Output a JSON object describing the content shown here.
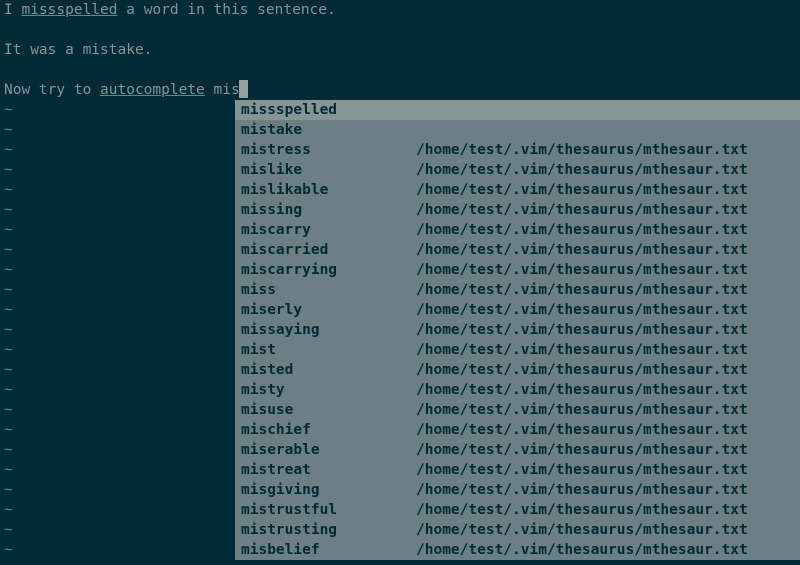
{
  "buffer": {
    "lines": [
      {
        "segments": [
          {
            "text": "I ",
            "cls": ""
          },
          {
            "text": "missspelled",
            "cls": "spell-error"
          },
          {
            "text": " a word in this sentence.",
            "cls": ""
          }
        ]
      },
      {
        "segments": [
          {
            "text": " ",
            "cls": ""
          }
        ]
      },
      {
        "segments": [
          {
            "text": "It was a mistake.",
            "cls": ""
          }
        ]
      },
      {
        "segments": [
          {
            "text": " ",
            "cls": ""
          }
        ]
      },
      {
        "segments": [
          {
            "text": "Now try to ",
            "cls": ""
          },
          {
            "text": "autocomplete",
            "cls": "spell-error"
          },
          {
            "text": " mis",
            "cls": ""
          }
        ],
        "cursor": true
      }
    ],
    "tilde_count": 23,
    "tilde_glyph": "~"
  },
  "completion": {
    "selected_index": 0,
    "thesaurus_path": "/home/test/.vim/thesaurus/mthesaur.txt",
    "items": [
      {
        "word": "missspelled",
        "src": ""
      },
      {
        "word": "mistake",
        "src": ""
      },
      {
        "word": "mistress",
        "src": "thesaurus"
      },
      {
        "word": "mislike",
        "src": "thesaurus"
      },
      {
        "word": "mislikable",
        "src": "thesaurus"
      },
      {
        "word": "missing",
        "src": "thesaurus"
      },
      {
        "word": "miscarry",
        "src": "thesaurus"
      },
      {
        "word": "miscarried",
        "src": "thesaurus"
      },
      {
        "word": "miscarrying",
        "src": "thesaurus"
      },
      {
        "word": "miss",
        "src": "thesaurus"
      },
      {
        "word": "miserly",
        "src": "thesaurus"
      },
      {
        "word": "missaying",
        "src": "thesaurus"
      },
      {
        "word": "mist",
        "src": "thesaurus"
      },
      {
        "word": "misted",
        "src": "thesaurus"
      },
      {
        "word": "misty",
        "src": "thesaurus"
      },
      {
        "word": "misuse",
        "src": "thesaurus"
      },
      {
        "word": "mischief",
        "src": "thesaurus"
      },
      {
        "word": "miserable",
        "src": "thesaurus"
      },
      {
        "word": "mistreat",
        "src": "thesaurus"
      },
      {
        "word": "misgiving",
        "src": "thesaurus"
      },
      {
        "word": "mistrustful",
        "src": "thesaurus"
      },
      {
        "word": "mistrusting",
        "src": "thesaurus"
      },
      {
        "word": "misbelief",
        "src": "thesaurus"
      }
    ]
  }
}
